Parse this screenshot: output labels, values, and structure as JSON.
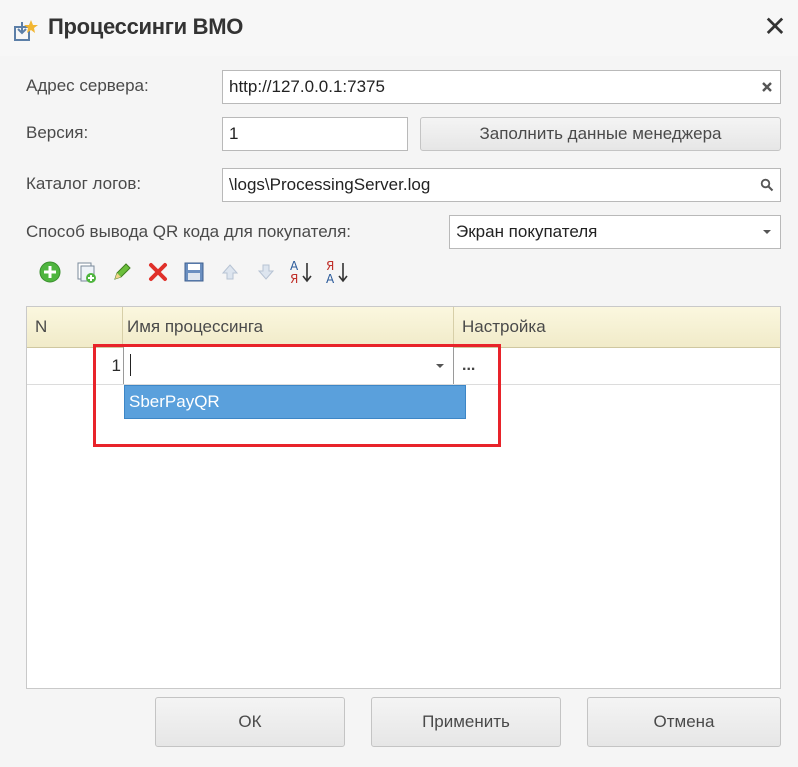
{
  "window": {
    "title": "Процессинги ВМО",
    "close_label": "✕"
  },
  "form": {
    "server_label": "Адрес сервера:",
    "server_value": "http://127.0.0.1:7375",
    "version_label": "Версия:",
    "version_value": "1",
    "fill_manager_label": "Заполнить данные менеджера",
    "log_dir_label": "Каталог логов:",
    "log_dir_value": "\\logs\\ProcessingServer.log",
    "qr_label": "Способ вывода QR кода для покупателя:",
    "qr_value": "Экран покупателя"
  },
  "toolbar": {
    "icons": [
      "add-icon",
      "copy-icon",
      "edit-icon",
      "delete-icon",
      "save-icon",
      "move-up-icon",
      "move-down-icon",
      "sort-asc-icon",
      "sort-desc-icon"
    ],
    "sort_asc_top": "А",
    "sort_asc_bottom": "Я",
    "sort_desc_top": "Я",
    "sort_desc_bottom": "А"
  },
  "table": {
    "columns": [
      "N",
      "Имя процессинга",
      "Настройка"
    ],
    "rows": [
      {
        "n": "1",
        "name": "",
        "setting": "..."
      }
    ],
    "dropdown_options": [
      "SberPayQR"
    ]
  },
  "buttons": {
    "ok": "ОК",
    "apply": "Применить",
    "cancel": "Отмена"
  },
  "colors": {
    "highlight": "#e8232a",
    "selection": "#5aa0dc",
    "header_bg": "#f1ebc9"
  }
}
